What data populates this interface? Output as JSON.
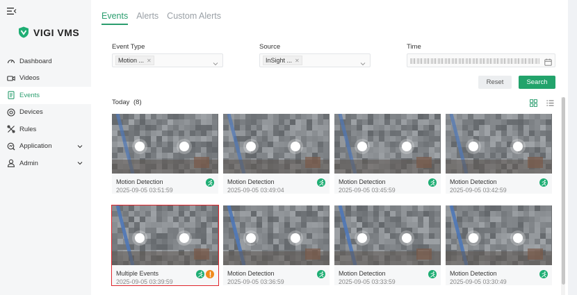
{
  "app": {
    "name": "VIGI VMS"
  },
  "sidebar": {
    "items": [
      {
        "label": "Dashboard",
        "icon": "dashboard-icon",
        "active": false
      },
      {
        "label": "Videos",
        "icon": "video-icon",
        "active": false
      },
      {
        "label": "Events",
        "icon": "events-icon",
        "active": true
      },
      {
        "label": "Devices",
        "icon": "devices-icon",
        "active": false
      },
      {
        "label": "Rules",
        "icon": "rules-icon",
        "active": false
      },
      {
        "label": "Application",
        "icon": "application-icon",
        "active": false,
        "expandable": true
      },
      {
        "label": "Admin",
        "icon": "admin-icon",
        "active": false,
        "expandable": true
      }
    ]
  },
  "tabs": [
    {
      "label": "Events",
      "active": true
    },
    {
      "label": "Alerts",
      "active": false
    },
    {
      "label": "Custom Alerts",
      "active": false
    }
  ],
  "filters": {
    "event_type": {
      "label": "Event Type",
      "value": "Motion ..."
    },
    "source": {
      "label": "Source",
      "value": "InSight ..."
    },
    "time": {
      "label": "Time"
    }
  },
  "buttons": {
    "reset": "Reset",
    "search": "Search"
  },
  "list": {
    "group_label": "Today",
    "count_label": "(8)"
  },
  "events": [
    {
      "title": "Motion Detection",
      "time": "2025-09-05 03:51:59",
      "badges": [
        "motion"
      ]
    },
    {
      "title": "Motion Detection",
      "time": "2025-09-05 03:49:04",
      "badges": [
        "motion"
      ]
    },
    {
      "title": "Motion Detection",
      "time": "2025-09-05 03:45:59",
      "badges": [
        "motion"
      ]
    },
    {
      "title": "Motion Detection",
      "time": "2025-09-05 03:42:59",
      "badges": [
        "motion"
      ]
    },
    {
      "title": "Multiple Events",
      "time": "2025-09-05 03:39:59",
      "badges": [
        "motion",
        "alarm"
      ],
      "selected": true
    },
    {
      "title": "Motion Detection",
      "time": "2025-09-05 03:36:59",
      "badges": [
        "motion"
      ]
    },
    {
      "title": "Motion Detection",
      "time": "2025-09-05 03:33:59",
      "badges": [
        "motion"
      ]
    },
    {
      "title": "Motion Detection",
      "time": "2025-09-05 03:30:49",
      "badges": [
        "motion"
      ]
    }
  ],
  "colors": {
    "accent": "#2a9d6e",
    "button_primary": "#22a36b",
    "badge_motion": "#1fae74",
    "badge_alarm": "#f08a1c",
    "selection": "#e0252b"
  }
}
